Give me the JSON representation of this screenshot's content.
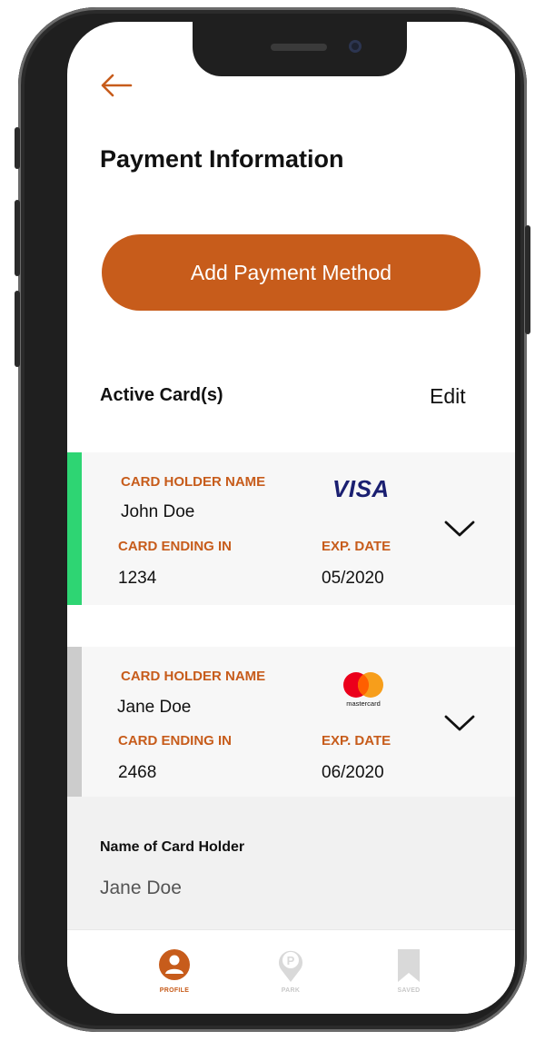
{
  "header": {
    "title": "Payment Information"
  },
  "actions": {
    "add_payment": "Add Payment Method"
  },
  "cards_section": {
    "title": "Active Card(s)",
    "edit_label": "Edit"
  },
  "cards": [
    {
      "holder_label": "CARD HOLDER NAME",
      "holder_name": "John Doe",
      "ending_label": "CARD ENDING IN",
      "ending": "1234",
      "exp_label": "EXP. DATE",
      "exp": "05/2020",
      "brand": "VISA",
      "status_color": "#2ed573"
    },
    {
      "holder_label": "CARD HOLDER NAME",
      "holder_name": "Jane Doe",
      "ending_label": "CARD ENDING IN",
      "ending": "2468",
      "exp_label": "EXP. DATE",
      "exp": "06/2020",
      "brand": "mastercard",
      "status_color": "#cccccc"
    }
  ],
  "form": {
    "label": "Name of Card Holder",
    "value": "Jane Doe"
  },
  "tabs": [
    {
      "label": "PROFILE",
      "icon": "profile-icon",
      "active": true
    },
    {
      "label": "PARK",
      "icon": "park-icon",
      "active": false
    },
    {
      "label": "SAVED",
      "icon": "bookmark-icon",
      "active": false
    }
  ],
  "colors": {
    "accent": "#c75c1b",
    "active_card": "#2ed573",
    "inactive_card": "#cccccc",
    "visa_blue": "#1a1f71"
  }
}
